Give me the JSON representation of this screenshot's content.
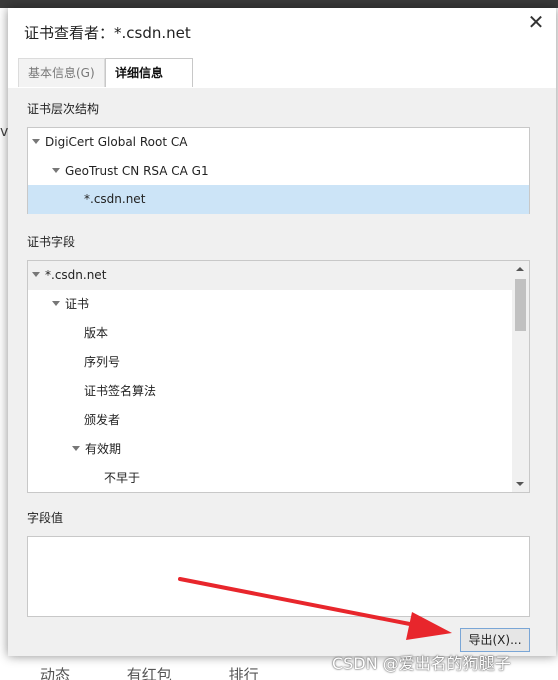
{
  "background": {
    "bottom_items": [
      "动态",
      "有红包",
      "排行"
    ],
    "side_letter": "v"
  },
  "dialog": {
    "title": "证书查看者：*.csdn.net",
    "tabs": [
      {
        "label": "基本信息(G)",
        "active": false
      },
      {
        "label": "详细信息(D)",
        "active": true
      }
    ],
    "hierarchy_label": "证书层次结构",
    "hierarchy": [
      {
        "label": "DigiCert Global Root CA",
        "expanded": true
      },
      {
        "label": "GeoTrust CN RSA CA G1",
        "expanded": true
      },
      {
        "label": "*.csdn.net",
        "selected": true
      }
    ],
    "fields_label": "证书字段",
    "fields": [
      {
        "label": "*.csdn.net",
        "expanded": true
      },
      {
        "label": "证书",
        "expanded": true
      },
      {
        "label": "版本"
      },
      {
        "label": "序列号"
      },
      {
        "label": "证书签名算法"
      },
      {
        "label": "颁发者"
      },
      {
        "label": "有效期",
        "expanded": true
      },
      {
        "label": "不早于"
      }
    ],
    "value_label": "字段值",
    "field_value": "",
    "export_label": "导出(X)..."
  },
  "annotation": {
    "color": "#e8262c"
  },
  "watermark": "CSDN @爱出名的狗腿子"
}
